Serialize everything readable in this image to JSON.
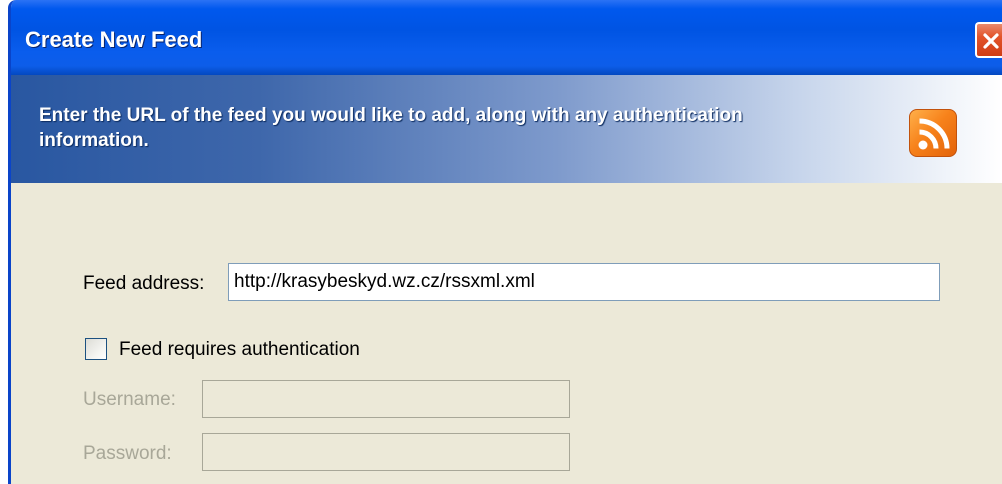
{
  "window": {
    "title": "Create New Feed"
  },
  "banner": {
    "instructions": "Enter the URL of the feed you would like to add, along with any authentication information.",
    "icon": "rss-feed-icon"
  },
  "form": {
    "feed_address": {
      "label": "Feed address:",
      "value": "http://krasybeskyd.wz.cz/rssxml.xml"
    },
    "requires_auth": {
      "label": "Feed requires authentication",
      "checked": false
    },
    "username": {
      "label": "Username:",
      "value": "",
      "enabled": false
    },
    "password": {
      "label": "Password:",
      "value": "",
      "enabled": false
    }
  },
  "colors": {
    "titlebar": "#0054e3",
    "dialog_background": "#ece9d8",
    "close_button": "#e3542a",
    "rss_orange": "#f7821b",
    "disabled_text": "#a8a798"
  }
}
